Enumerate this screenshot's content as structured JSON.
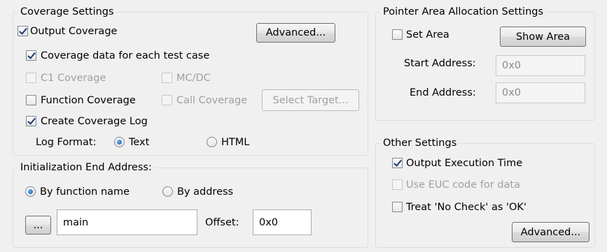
{
  "coverage": {
    "title": "Coverage Settings",
    "output_coverage": "Output Coverage",
    "advanced_button": "Advanced...",
    "each_test_case": "Coverage data for each test case",
    "c1": "C1 Coverage",
    "mcdc": "MC/DC",
    "function_coverage": "Function Coverage",
    "call_coverage": "Call Coverage",
    "select_target": "Select Target...",
    "create_log": "Create Coverage Log",
    "log_format_label": "Log Format:",
    "log_text": "Text",
    "log_html": "HTML"
  },
  "init": {
    "title": "Initialization End Address:",
    "by_function": "By function name",
    "by_address": "By address",
    "browse_button": "...",
    "function_value": "main",
    "offset_label": "Offset:",
    "offset_value": "0x0"
  },
  "pointer": {
    "title": "Pointer Area Allocation Settings",
    "set_area": "Set Area",
    "show_area_button": "Show Area",
    "start_label": "Start Address:",
    "start_value": "0x0",
    "end_label": "End Address:",
    "end_value": "0x0"
  },
  "other": {
    "title": "Other Settings",
    "exec_time": "Output Execution Time",
    "euc": "Use EUC code for data",
    "no_check": "Treat 'No Check' as 'OK'",
    "advanced_button": "Advanced..."
  }
}
